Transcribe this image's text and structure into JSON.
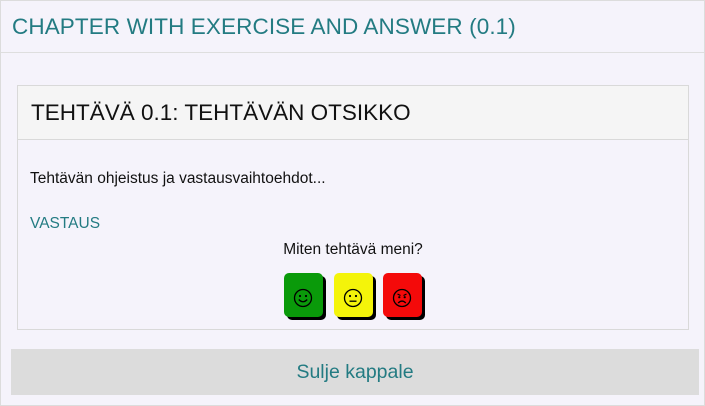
{
  "chapter": {
    "title": "CHAPTER WITH EXERCISE AND ANSWER (0.1)"
  },
  "exercise": {
    "title": "TEHTÄVÄ 0.1: TEHTÄVÄN OTSIKKO",
    "instructions": "Tehtävän ohjeistus ja vastausvaihtoehdot...",
    "answer_link": "VASTAUS",
    "feedback": {
      "question": "Miten tehtävä meni?",
      "options": [
        {
          "icon": "smiley-happy-icon",
          "color": "#0a9a0a"
        },
        {
          "icon": "smiley-neutral-icon",
          "color": "#f4f40a"
        },
        {
          "icon": "smiley-angry-icon",
          "color": "#f40a0a"
        }
      ]
    }
  },
  "footer": {
    "close_label": "Sulje kappale"
  }
}
